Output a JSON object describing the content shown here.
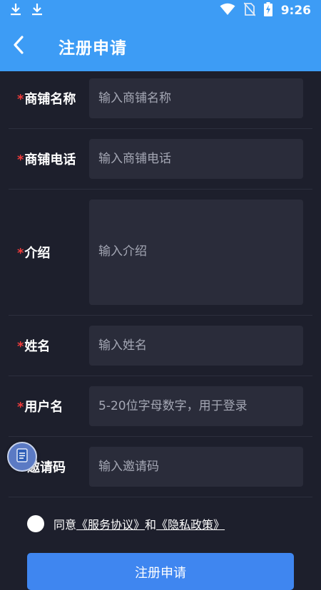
{
  "status_bar": {
    "time": "9:26",
    "icons": [
      "download-icon",
      "download-icon",
      "wifi-icon",
      "no-sim-icon",
      "battery-charging-icon"
    ]
  },
  "app_bar": {
    "title": "注册申请",
    "back_icon": "back-arrow-icon"
  },
  "form": {
    "fields": [
      {
        "label": "商铺名称",
        "required": true,
        "placeholder": "输入商铺名称",
        "value": ""
      },
      {
        "label": "商铺电话",
        "required": true,
        "placeholder": "输入商铺电话",
        "value": ""
      },
      {
        "label": "介绍",
        "required": true,
        "placeholder": "输入介绍",
        "value": ""
      },
      {
        "label": "姓名",
        "required": true,
        "placeholder": "输入姓名",
        "value": ""
      },
      {
        "label": "用户名",
        "required": true,
        "placeholder": "5-20位字母数字，用于登录",
        "value": ""
      },
      {
        "label": "邀请码",
        "required": false,
        "placeholder": "输入邀请码",
        "value": ""
      }
    ],
    "required_mark": "*"
  },
  "agreement": {
    "prefix": "同意",
    "service_link": "《服务协议》",
    "conjunction": "和",
    "privacy_link": "《隐私政策》"
  },
  "submit": {
    "label": "注册申请"
  },
  "colors": {
    "primary": "#3d9cf5",
    "background": "#1d1f2c",
    "input_bg": "#2a2c3a",
    "required": "#ef3b3b",
    "button": "#3f86f0"
  }
}
